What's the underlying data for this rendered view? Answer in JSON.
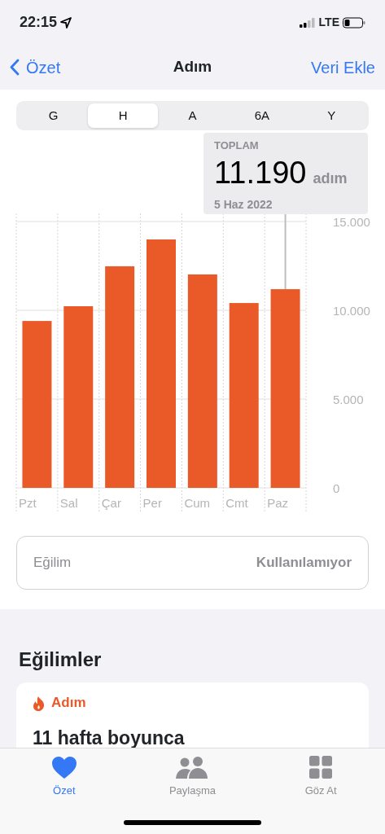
{
  "status_bar": {
    "time": "22:15",
    "network": "LTE"
  },
  "nav": {
    "back": "Özet",
    "title": "Adım",
    "action": "Veri Ekle"
  },
  "ranges": [
    {
      "label": "G",
      "selected": false
    },
    {
      "label": "H",
      "selected": true
    },
    {
      "label": "A",
      "selected": false
    },
    {
      "label": "6A",
      "selected": false
    },
    {
      "label": "Y",
      "selected": false
    }
  ],
  "callout": {
    "label": "TOPLAM",
    "value": "11.190",
    "unit": "adım",
    "date": "5 Haz 2022"
  },
  "chart": {
    "chart_data": {
      "type": "bar",
      "categories": [
        "Pzt",
        "Sal",
        "Çar",
        "Per",
        "Cum",
        "Cmt",
        "Paz"
      ],
      "values": [
        9400,
        10230,
        12480,
        13990,
        12020,
        10410,
        11190
      ],
      "ylim": [
        0,
        15000
      ],
      "yticks": [
        {
          "value": 0,
          "label": "0"
        },
        {
          "value": 5000,
          "label": "5.000"
        },
        {
          "value": 10000,
          "label": "10.000"
        },
        {
          "value": 15000,
          "label": "15.000"
        }
      ]
    },
    "bars": [
      {
        "selected": false
      },
      {
        "selected": false
      },
      {
        "selected": false
      },
      {
        "selected": false
      },
      {
        "selected": false
      },
      {
        "selected": false
      },
      {
        "selected": true
      }
    ]
  },
  "trend": {
    "label": "Eğilim",
    "value": "Kullanılamıyor"
  },
  "trends_section": {
    "title": "Eğilimler",
    "card": {
      "category": "Adım",
      "headline": "11 hafta boyunca"
    }
  },
  "tab_bar": [
    {
      "label": "Özet",
      "selected": true
    },
    {
      "label": "Paylaşma",
      "selected": false
    },
    {
      "label": "Göz At",
      "selected": false
    }
  ]
}
